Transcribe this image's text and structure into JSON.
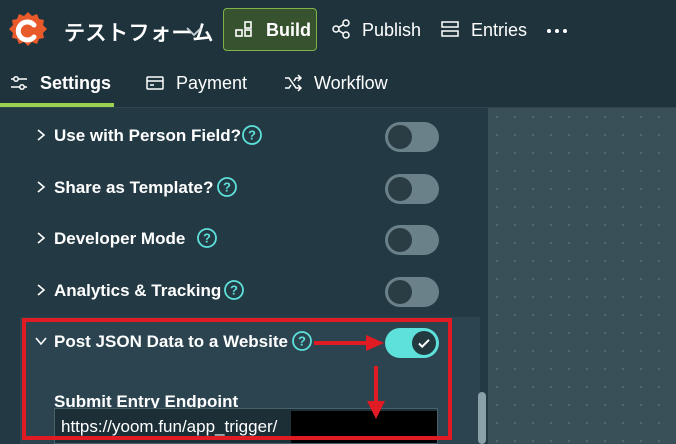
{
  "app": {
    "form_title": "テストフォーム",
    "brand_color": "#e85a2a"
  },
  "nav": {
    "build_label": "Build",
    "publish_label": "Publish",
    "entries_label": "Entries",
    "active": "Build"
  },
  "tabs": [
    {
      "label": "Settings",
      "icon": "sliders-icon",
      "active": true
    },
    {
      "label": "Payment",
      "icon": "card-icon",
      "active": false
    },
    {
      "label": "Workflow",
      "icon": "shuffle-icon",
      "active": false
    }
  ],
  "settings": {
    "rows": [
      {
        "label": "Use with Person Field?",
        "enabled": false
      },
      {
        "label": "Share as Template?",
        "enabled": false
      },
      {
        "label": "Developer Mode",
        "enabled": false
      },
      {
        "label": "Analytics & Tracking",
        "enabled": false
      },
      {
        "label": "Post JSON Data to a Website",
        "enabled": true,
        "expanded": true
      }
    ],
    "endpoint": {
      "label": "Submit Entry Endpoint",
      "value": "https://yoom.fun/app_trigger/"
    }
  },
  "colors": {
    "accent_green": "#9bd14f",
    "toggle_on": "#5ee0db",
    "annotation_red": "#e01b24"
  }
}
